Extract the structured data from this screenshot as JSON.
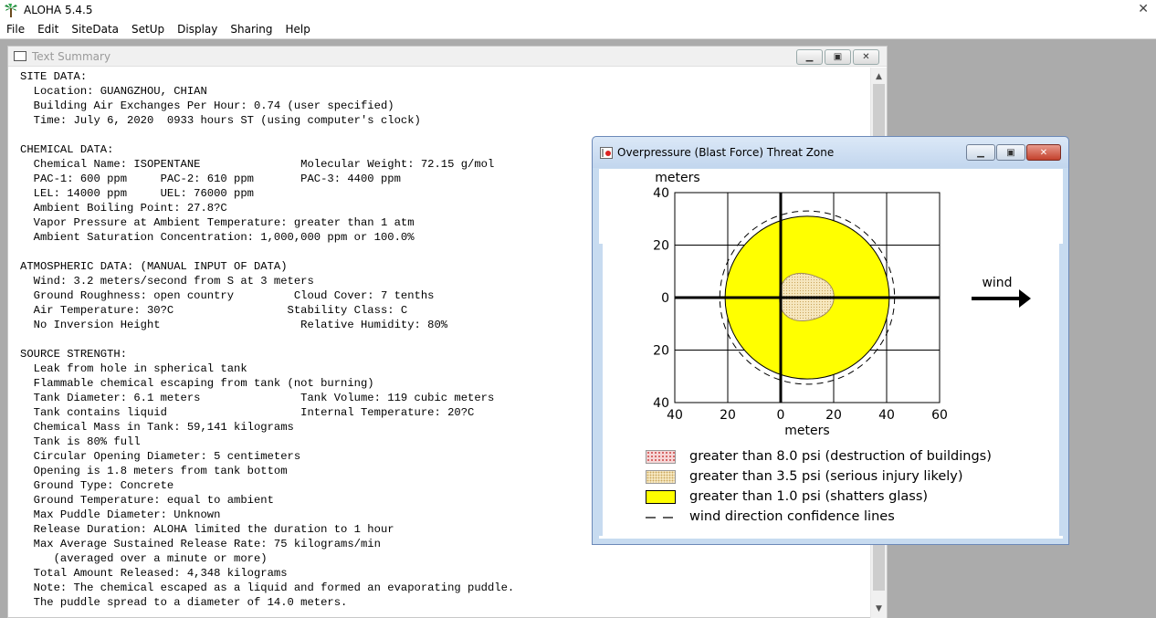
{
  "app": {
    "title": "ALOHA 5.4.5",
    "close": "✕"
  },
  "menu": [
    "File",
    "Edit",
    "SiteData",
    "SetUp",
    "Display",
    "Sharing",
    "Help"
  ],
  "summary_window": {
    "title": "Text Summary",
    "lines": [
      "SITE DATA:",
      "  Location: GUANGZHOU, CHIAN",
      "  Building Air Exchanges Per Hour: 0.74 (user specified)",
      "  Time: July 6, 2020  0933 hours ST (using computer's clock)",
      "",
      "CHEMICAL DATA:",
      "  Chemical Name: ISOPENTANE               Molecular Weight: 72.15 g/mol",
      "  PAC-1: 600 ppm     PAC-2: 610 ppm       PAC-3: 4400 ppm",
      "  LEL: 14000 ppm     UEL: 76000 ppm",
      "  Ambient Boiling Point: 27.8?C",
      "  Vapor Pressure at Ambient Temperature: greater than 1 atm",
      "  Ambient Saturation Concentration: 1,000,000 ppm or 100.0%",
      "",
      "ATMOSPHERIC DATA: (MANUAL INPUT OF DATA)",
      "  Wind: 3.2 meters/second from S at 3 meters",
      "  Ground Roughness: open country         Cloud Cover: 7 tenths",
      "  Air Temperature: 30?C                 Stability Class: C",
      "  No Inversion Height                     Relative Humidity: 80%",
      "",
      "SOURCE STRENGTH:",
      "  Leak from hole in spherical tank",
      "  Flammable chemical escaping from tank (not burning)",
      "  Tank Diameter: 6.1 meters               Tank Volume: 119 cubic meters",
      "  Tank contains liquid                    Internal Temperature: 20?C",
      "  Chemical Mass in Tank: 59,141 kilograms",
      "  Tank is 80% full",
      "  Circular Opening Diameter: 5 centimeters",
      "  Opening is 1.8 meters from tank bottom",
      "  Ground Type: Concrete",
      "  Ground Temperature: equal to ambient",
      "  Max Puddle Diameter: Unknown",
      "  Release Duration: ALOHA limited the duration to 1 hour",
      "  Max Average Sustained Release Rate: 75 kilograms/min",
      "     (averaged over a minute or more)",
      "  Total Amount Released: 4,348 kilograms",
      "  Note: The chemical escaped as a liquid and formed an evaporating puddle.",
      "  The puddle spread to a diameter of 14.0 meters."
    ]
  },
  "threat_window": {
    "title": "Overpressure (Blast Force) Threat Zone",
    "close": "✕",
    "y_unit": "meters",
    "x_unit": "meters",
    "wind_label": "wind",
    "legend": [
      {
        "label": "greater than 8.0 psi (destruction of buildings)",
        "color": "#f6d6d6"
      },
      {
        "label": "greater than 3.5 psi (serious injury likely)",
        "color": "#f6e7bf"
      },
      {
        "label": "greater than 1.0 psi (shatters glass)",
        "color": "#ffff00"
      },
      {
        "label": "wind direction confidence lines",
        "color": "#000000"
      }
    ]
  },
  "chart_data": {
    "type": "map",
    "x_ticks": [
      "40",
      "20",
      "0",
      "20",
      "40",
      "60"
    ],
    "x_values": [
      -40,
      -20,
      0,
      20,
      40,
      60
    ],
    "y_ticks": [
      "40",
      "20",
      "0",
      "20",
      "40"
    ],
    "y_values": [
      40,
      20,
      0,
      -20,
      -40
    ],
    "xlim": [
      -40,
      60
    ],
    "ylim": [
      -40,
      40
    ],
    "zones": [
      {
        "name": "greater than 1.0 psi (shatters glass)",
        "center_x": 10,
        "center_y": 0,
        "radius": 31,
        "color": "#ffff00"
      },
      {
        "name": "greater than 3.5 psi (serious injury likely)",
        "center_x": 10,
        "center_y": 0,
        "radius_x": 10.5,
        "radius_y": 8.5,
        "color": "#f6e7bf"
      }
    ],
    "confidence_circle": {
      "center_x": 10,
      "center_y": 0,
      "radius": 33
    },
    "wind_direction": "east"
  }
}
